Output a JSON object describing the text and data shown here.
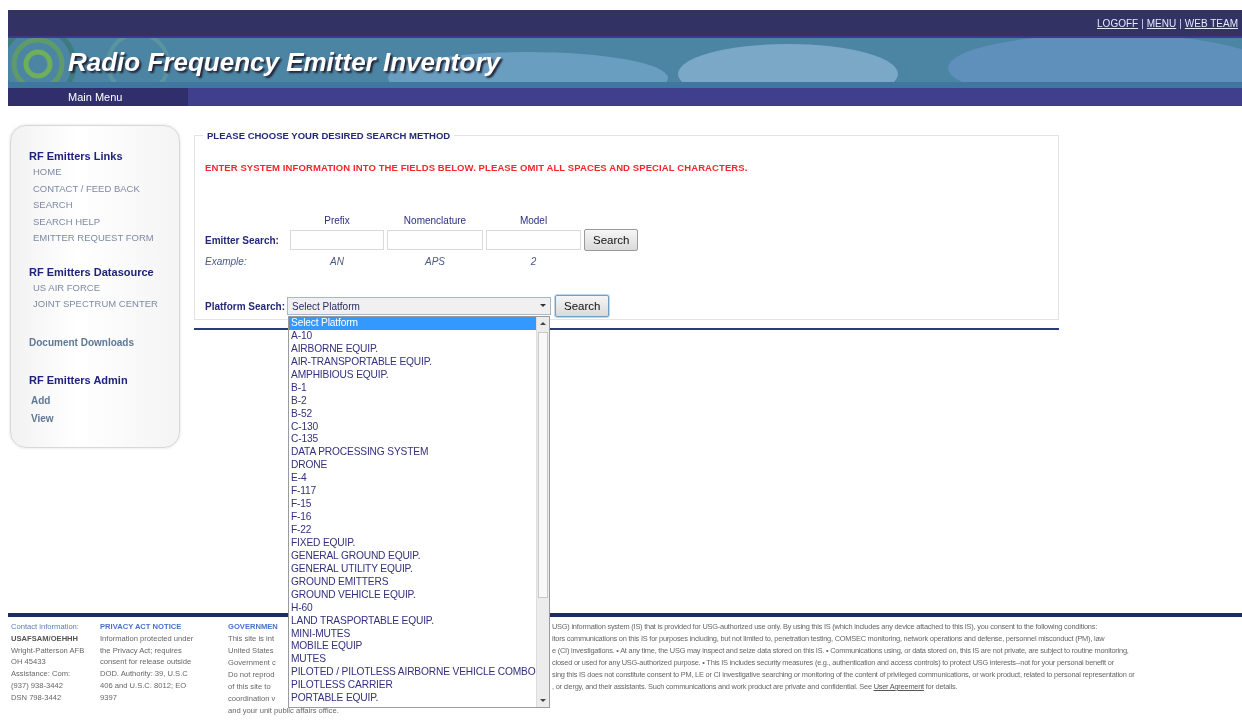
{
  "header": {
    "links": [
      "LOGOFF",
      "MENU",
      "WEB TEAM"
    ],
    "separator": "|",
    "title": "Radio Frequency Emitter Inventory",
    "nav": "Main Menu"
  },
  "sidebar": {
    "sections": [
      {
        "kind": "group",
        "heading": "RF Emitters Links",
        "items": [
          "HOME",
          "CONTACT / FEED BACK",
          "SEARCH",
          "SEARCH HELP",
          "EMITTER REQUEST FORM"
        ]
      },
      {
        "kind": "group",
        "heading": "RF Emitters Datasource",
        "items": [
          "US AIR FORCE",
          "JOINT SPECTRUM CENTER"
        ]
      },
      {
        "kind": "link",
        "heading": "Document Downloads"
      },
      {
        "kind": "admin",
        "heading": "RF Emitters Admin",
        "items": [
          "Add",
          "View"
        ]
      }
    ]
  },
  "form": {
    "legend": "PLEASE CHOOSE YOUR DESIRED SEARCH METHOD",
    "instruction": "ENTER SYSTEM INFORMATION INTO THE FIELDS BELOW. PLEASE OMIT ALL SPACES AND SPECIAL CHARACTERS.",
    "emitter": {
      "label": "Emitter Search:",
      "columns": [
        "Prefix",
        "Nomenclature",
        "Model"
      ],
      "button": "Search",
      "example_label": "Example:",
      "examples": [
        "AN",
        "APS",
        "2"
      ]
    },
    "platform": {
      "label": "Platform Search:",
      "value": "Select Platform",
      "button": "Search",
      "options": [
        {
          "label": "Select Platform",
          "selected": true
        },
        {
          "label": "A-10",
          "selected": false
        },
        {
          "label": "AIRBORNE EQUIP.",
          "selected": false
        },
        {
          "label": "AIR-TRANSPORTABLE EQUIP.",
          "selected": false
        },
        {
          "label": "AMPHIBIOUS EQUIP.",
          "selected": false
        },
        {
          "label": "B-1",
          "selected": false
        },
        {
          "label": "B-2",
          "selected": false
        },
        {
          "label": "B-52",
          "selected": false
        },
        {
          "label": "C-130",
          "selected": false
        },
        {
          "label": "C-135",
          "selected": false
        },
        {
          "label": "DATA PROCESSING SYSTEM",
          "selected": false
        },
        {
          "label": "DRONE",
          "selected": false
        },
        {
          "label": "E-4",
          "selected": false
        },
        {
          "label": "F-117",
          "selected": false
        },
        {
          "label": "F-15",
          "selected": false
        },
        {
          "label": "F-16",
          "selected": false
        },
        {
          "label": "F-22",
          "selected": false
        },
        {
          "label": "FIXED EQUIP.",
          "selected": false
        },
        {
          "label": "GENERAL GROUND EQUIP.",
          "selected": false
        },
        {
          "label": "GENERAL UTILITY EQUIP.",
          "selected": false
        },
        {
          "label": "GROUND EMITTERS",
          "selected": false
        },
        {
          "label": "GROUND VEHICLE EQUIP.",
          "selected": false
        },
        {
          "label": "H-60",
          "selected": false
        },
        {
          "label": "LAND TRASPORTABLE EQUIP.",
          "selected": false
        },
        {
          "label": "MINI-MUTES",
          "selected": false
        },
        {
          "label": "MOBILE EQUIP",
          "selected": false
        },
        {
          "label": "MUTES",
          "selected": false
        },
        {
          "label": "PILOTED / PILOTLESS AIRBORNE VEHICLE COMBO",
          "selected": false
        },
        {
          "label": "PILOTLESS CARRIER",
          "selected": false
        },
        {
          "label": "PORTABLE EQUIP.",
          "selected": false
        }
      ]
    }
  },
  "footer": {
    "contact": {
      "heading": "Contact information:",
      "org": "USAFSAM/OEHHH",
      "lines": [
        "Wright-Patterson AFB",
        "OH 45433",
        "Assistance: Com:",
        "(937) 938-3442",
        "DSN 798-3442"
      ]
    },
    "privacy": {
      "heading": "PRIVACY ACT NOTICE",
      "text": "Information protected under the Privacy Act; requires consent for release outside DOD. Authority: 39, U.S.C 406 and U.S.C. 8012; EO 9397"
    },
    "government": {
      "heading": "GOVERNMEN",
      "lines": [
        "This site is int",
        "United States",
        "Government c",
        "Do not reprod",
        "of this site to",
        "coordination v",
        "and your unit public affairs office."
      ]
    },
    "notice": {
      "lines": [
        "USG) information system (IS) that is provided for USG-authorized use only. By using this IS (which includes any device attached to this IS), you consent to the following conditions:",
        "itors communications on this IS for purposes including, but not limited to, penetration testing, COMSEC monitoring, network operations and defense, personnel misconduct (PM), law",
        "e (CI) investigations. • At any time, the USG may inspect and seize data stored on this IS. • Communications using, or data stored on, this IS are not private, are subject to routine monitoring,",
        "closed or used for any USG-authorized purpose. • This IS includes security measures (e.g., authentication and access controls) to protect USG interests--not for your personal benefit or",
        "sing this IS does not constitute consent to PM, LE or CI investigative searching or monitoring of the content of privileged communications, or work product, related to personal representation or"
      ],
      "last_line": {
        "before": ", or clergy, and their assistants. Such communications and work product are private and confidential. See",
        "link": "User Agreement",
        "after": "for details."
      }
    }
  }
}
